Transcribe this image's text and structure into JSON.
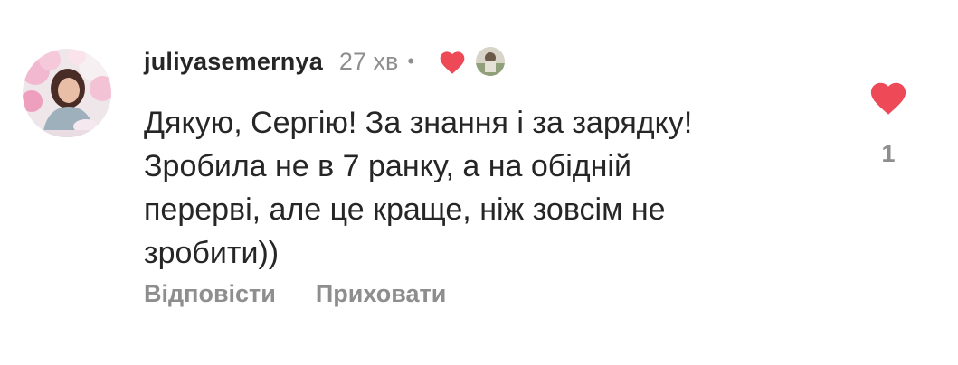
{
  "comment": {
    "username": "juliyasemernya",
    "time": "27 хв",
    "separator": "•",
    "text": "Дякую, Сергію! За знання і за зарядку!\nЗробила не в 7 ранку, а на обідній\nперерві, але це краще, ніж зовсім не\nзробити))",
    "reply_label": "Відповісти",
    "hide_label": "Приховати",
    "like_count": "1"
  },
  "icons": {
    "like": "heart-icon",
    "creator_like": "heart-icon"
  },
  "colors": {
    "like_red": "#ed4956",
    "muted_text": "#8e8e8e",
    "primary_text": "#262626"
  }
}
